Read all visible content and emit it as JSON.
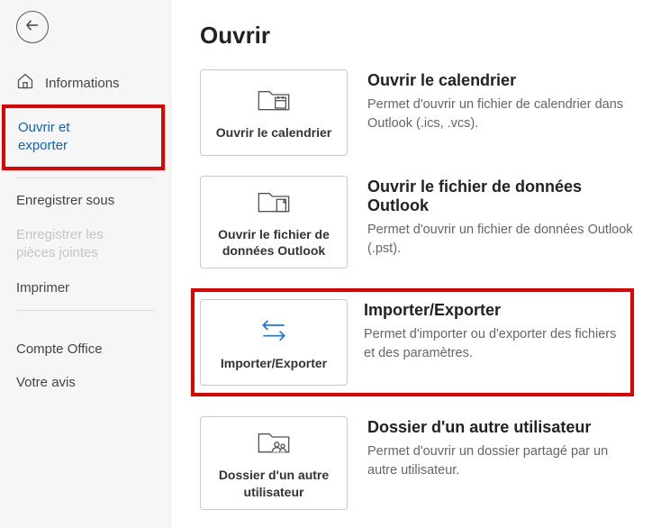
{
  "sidebar": {
    "items": {
      "info": "Informations",
      "open": "Ouvrir et\nexporter",
      "saveas": "Enregistrer sous",
      "attachments": "Enregistrer les\npièces jointes",
      "print": "Imprimer",
      "account": "Compte Office",
      "feedback": "Votre avis"
    }
  },
  "page": {
    "title": "Ouvrir"
  },
  "options": {
    "calendar": {
      "tile": "Ouvrir le calendrier",
      "title": "Ouvrir le calendrier",
      "desc": "Permet d'ouvrir un fichier de calendrier dans Outlook (.ics, .vcs)."
    },
    "datafile": {
      "tile": "Ouvrir le fichier de données Outlook",
      "title": "Ouvrir le fichier de données Outlook",
      "desc": "Permet d'ouvrir un fichier de données Outlook (.pst)."
    },
    "import": {
      "tile": "Importer/Exporter",
      "title": "Importer/Exporter",
      "desc": "Permet d'importer ou d'exporter des fichiers et des paramètres."
    },
    "otheruser": {
      "tile": "Dossier d'un autre utilisateur",
      "title": "Dossier d'un autre utilisateur",
      "desc": "Permet d'ouvrir un dossier partagé par un autre utilisateur."
    }
  }
}
